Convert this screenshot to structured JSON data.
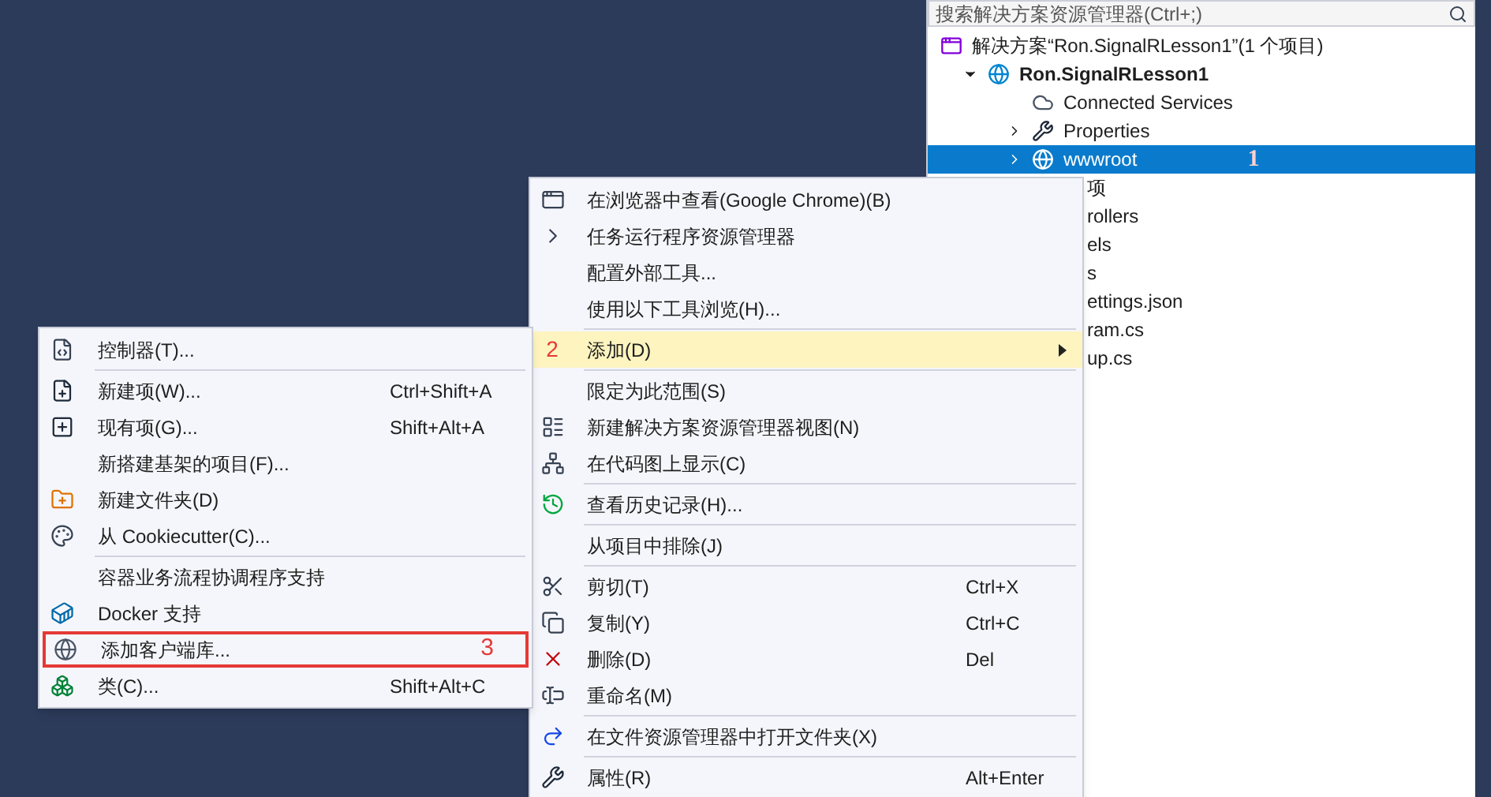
{
  "solution_explorer": {
    "search": {
      "placeholder": "搜索解决方案资源管理器(Ctrl+;)"
    },
    "tree": [
      {
        "label": "解决方案“Ron.SignalRLesson1”(1 个项目)",
        "kind": "solution",
        "selected": false,
        "children": [
          {
            "label": "Ron.SignalRLesson1",
            "kind": "project",
            "expanded": true,
            "selected": false,
            "children": [
              {
                "label": "Connected Services",
                "kind": "services",
                "selected": false
              },
              {
                "label": "Properties",
                "kind": "properties",
                "expanded": false,
                "selected": false
              },
              {
                "label": "wwwroot",
                "kind": "folder",
                "expanded": false,
                "selected": true,
                "annotation": "1"
              },
              {
                "label": "项",
                "kind": "clipped",
                "selected": false
              },
              {
                "label": "rollers",
                "kind": "clipped",
                "selected": false
              },
              {
                "label": "els",
                "kind": "clipped",
                "selected": false
              },
              {
                "label": "s",
                "kind": "clipped",
                "selected": false
              },
              {
                "label": "ettings.json",
                "kind": "clipped",
                "selected": false
              },
              {
                "label": "ram.cs",
                "kind": "clipped",
                "selected": false
              },
              {
                "label": "up.cs",
                "kind": "clipped",
                "selected": false
              }
            ]
          }
        ]
      }
    ]
  },
  "context_menu": {
    "items": [
      {
        "kind": "item",
        "label": "在浏览器中查看(Google Chrome)(B)",
        "highlighted": false
      },
      {
        "kind": "item",
        "label": "任务运行程序资源管理器",
        "highlighted": false
      },
      {
        "kind": "item",
        "label": "配置外部工具...",
        "highlighted": false
      },
      {
        "kind": "item",
        "label": "使用以下工具浏览(H)...",
        "highlighted": false
      },
      {
        "kind": "separator"
      },
      {
        "kind": "submenu",
        "label": "添加(D)",
        "highlighted": true,
        "annotation": "2"
      },
      {
        "kind": "separator"
      },
      {
        "kind": "item",
        "label": "限定为此范围(S)",
        "highlighted": false
      },
      {
        "kind": "item",
        "label": "新建解决方案资源管理器视图(N)",
        "highlighted": false
      },
      {
        "kind": "item",
        "label": "在代码图上显示(C)",
        "highlighted": false
      },
      {
        "kind": "separator"
      },
      {
        "kind": "item",
        "label": "查看历史记录(H)...",
        "highlighted": false
      },
      {
        "kind": "separator"
      },
      {
        "kind": "item",
        "label": "从项目中排除(J)",
        "highlighted": false
      },
      {
        "kind": "separator"
      },
      {
        "kind": "item",
        "label": "剪切(T)",
        "shortcut": "Ctrl+X",
        "highlighted": false
      },
      {
        "kind": "item",
        "label": "复制(Y)",
        "shortcut": "Ctrl+C",
        "highlighted": false
      },
      {
        "kind": "item",
        "label": "删除(D)",
        "shortcut": "Del",
        "highlighted": false
      },
      {
        "kind": "item",
        "label": "重命名(M)",
        "highlighted": false
      },
      {
        "kind": "separator"
      },
      {
        "kind": "item",
        "label": "在文件资源管理器中打开文件夹(X)",
        "highlighted": false
      },
      {
        "kind": "separator"
      },
      {
        "kind": "item",
        "label": "属性(R)",
        "shortcut": "Alt+Enter",
        "highlighted": false
      }
    ]
  },
  "add_submenu": {
    "items": [
      {
        "kind": "item",
        "label": "控制器(T)...",
        "marked": false
      },
      {
        "kind": "separator"
      },
      {
        "kind": "item",
        "label": "新建项(W)...",
        "shortcut": "Ctrl+Shift+A",
        "marked": false
      },
      {
        "kind": "item",
        "label": "现有项(G)...",
        "shortcut": "Shift+Alt+A",
        "marked": false
      },
      {
        "kind": "item",
        "label": "新搭建基架的项目(F)...",
        "marked": false
      },
      {
        "kind": "item",
        "label": "新建文件夹(D)",
        "marked": false
      },
      {
        "kind": "item",
        "label": "从 Cookiecutter(C)...",
        "marked": false
      },
      {
        "kind": "separator"
      },
      {
        "kind": "item",
        "label": "容器业务流程协调程序支持",
        "marked": false
      },
      {
        "kind": "item",
        "label": "Docker 支持",
        "marked": false
      },
      {
        "kind": "item",
        "label": "添加客户端库...",
        "marked": true,
        "annotation": "3"
      },
      {
        "kind": "item",
        "label": "类(C)...",
        "shortcut": "Shift+Alt+C",
        "marked": false
      }
    ]
  }
}
